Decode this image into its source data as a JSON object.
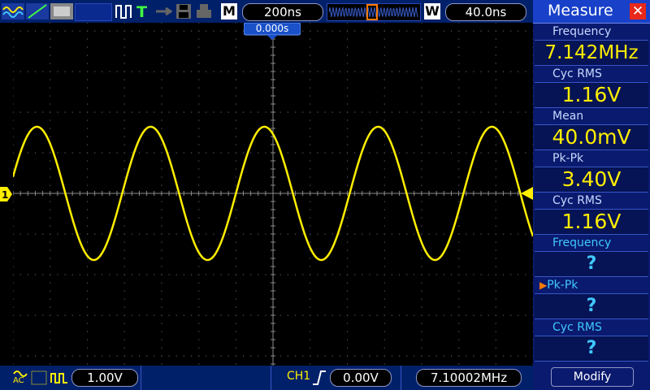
{
  "top_bar": {
    "mode_label": "M",
    "timebase": "200ns",
    "window_label": "W",
    "trigger_delay": "40.0ns"
  },
  "screen": {
    "trigger_time_marker": "0.000s",
    "channel_marker": "1"
  },
  "bottom_bar": {
    "ch1_scale": "1.00V",
    "trigger_channel": "CH1",
    "trigger_level": "0.00V",
    "frequency_counter": "7.10002MHz",
    "coupling_label": "AC"
  },
  "measure_panel": {
    "title": "Measure",
    "items": [
      {
        "label": "Frequency",
        "value": "7.142MHz"
      },
      {
        "label": "Cyc RMS",
        "value": "1.16V"
      },
      {
        "label": "Mean",
        "value": "40.0mV"
      },
      {
        "label": "Pk-Pk",
        "value": "3.40V"
      },
      {
        "label": "Cyc RMS",
        "value": "1.16V"
      },
      {
        "label": "Frequency",
        "value": "?"
      },
      {
        "label": "Pk-Pk",
        "value": "?"
      },
      {
        "label": "Cyc RMS",
        "value": "?"
      }
    ],
    "modify_label": "Modify"
  },
  "colors": {
    "trace": "#ffee00",
    "panel_bg": "#0a1a6e",
    "bar_bg": "#00206a",
    "accent_orange": "#ff7a00",
    "close_red": "#e8281a"
  }
}
